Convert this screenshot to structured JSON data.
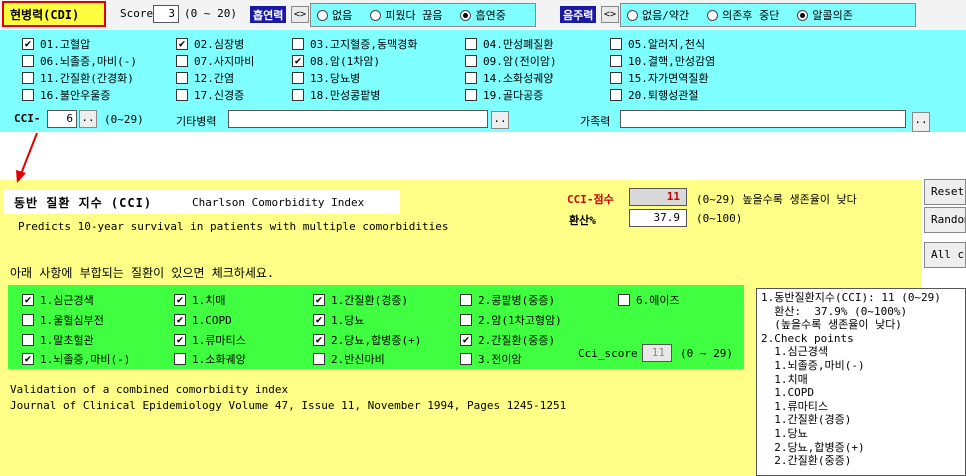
{
  "header": {
    "title": "현병력(CDI)",
    "score_label": "Score",
    "score_value": "3",
    "score_range": "(0 ~ 20)",
    "smoking_label": "흡연력",
    "drinking_label": "음주력",
    "swap_symbol": "<>",
    "smoking_options": [
      {
        "label": "없음",
        "selected": false
      },
      {
        "label": "피웠다 끊음",
        "selected": false
      },
      {
        "label": "흡연중",
        "selected": true
      }
    ],
    "drinking_options": [
      {
        "label": "없음/약간",
        "selected": false
      },
      {
        "label": "의존후 중단",
        "selected": false
      },
      {
        "label": "알콜의존",
        "selected": true
      }
    ]
  },
  "diseases": [
    {
      "label": "01.고혈압",
      "checked": true
    },
    {
      "label": "02.심장병",
      "checked": true
    },
    {
      "label": "03.고지혈증,동맥경화",
      "checked": false
    },
    {
      "label": "04.만성폐질환",
      "checked": false
    },
    {
      "label": "05.알러지,천식",
      "checked": false
    },
    {
      "label": "06.뇌졸증,마비(-)",
      "checked": false
    },
    {
      "label": "07.사지마비",
      "checked": false
    },
    {
      "label": "08.암(1차암)",
      "checked": true
    },
    {
      "label": "09.암(전이암)",
      "checked": false
    },
    {
      "label": "10.결핵,만성감염",
      "checked": false
    },
    {
      "label": "11.간질환(간경화)",
      "checked": false
    },
    {
      "label": "12.간염",
      "checked": false
    },
    {
      "label": "13.당뇨병",
      "checked": false
    },
    {
      "label": "14.소화성궤양",
      "checked": false
    },
    {
      "label": "15.자가면역질환",
      "checked": false
    },
    {
      "label": "16.불안우울증",
      "checked": false
    },
    {
      "label": "17.신경증",
      "checked": false
    },
    {
      "label": "18.만성콩팥병",
      "checked": false
    },
    {
      "label": "19.골다공증",
      "checked": false
    },
    {
      "label": "20.퇴행성관절",
      "checked": false
    }
  ],
  "cci_row": {
    "label": "CCI-",
    "value": "6",
    "dots": "..",
    "range": "(0~29)",
    "other_label": "기타병력",
    "family_label": "가족력"
  },
  "cci_panel": {
    "title": "동반 질환 지수 (CCI)",
    "subtitle": "Charlson Comorbidity Index",
    "description": "Predicts 10-year survival in patients with multiple comorbidities",
    "score_label": "CCI-점수",
    "score_value": "11",
    "score_note": "(0~29)  높을수록 생존율이 낮다",
    "pct_label": "환산%",
    "pct_value": "37.9",
    "pct_range": "(0~100)",
    "instruction": "아래 사항에 부합되는 질환이 있으면 체크하세요.",
    "items": [
      {
        "label": "1.심근경색",
        "checked": true
      },
      {
        "label": "1.치매",
        "checked": true
      },
      {
        "label": "1.간질환(경증)",
        "checked": true
      },
      {
        "label": "2.콩팥병(중증)",
        "checked": false
      },
      {
        "label": "6.에이즈",
        "checked": false
      },
      {
        "label": "1.울혈심부전",
        "checked": false
      },
      {
        "label": "1.COPD",
        "checked": true
      },
      {
        "label": "1.당뇨",
        "checked": true
      },
      {
        "label": "2.암(1차고형암)",
        "checked": false
      },
      {
        "label": "1.말초혈관",
        "checked": false
      },
      {
        "label": "1.류마티스",
        "checked": true
      },
      {
        "label": "2.당뇨,합병증(+)",
        "checked": true
      },
      {
        "label": "2.간질환(중증)",
        "checked": true
      },
      {
        "label": "1.뇌졸증,마비(-)",
        "checked": true
      },
      {
        "label": "1.소화궤양",
        "checked": false
      },
      {
        "label": "2.반신마비",
        "checked": false
      },
      {
        "label": "3.전이암",
        "checked": false
      }
    ],
    "cci_score_label": "Cci_score",
    "cci_score_value": "11",
    "cci_score_range": "(0 ~ 29)",
    "ref_title": "Validation of a combined comorbidity index",
    "ref_journal": "Journal of Clinical Epidemiology Volume 47, Issue 11, November 1994, Pages 1245-1251"
  },
  "buttons": {
    "reset": "Reset",
    "random": "Random",
    "all": "All clear"
  },
  "result_text": "1.동반질환지수(CCI): 11 (0~29)\n  환산:  37.9% (0~100%)\n  (높을수록 생존율이 낮다)\n2.Check points\n  1.심근경색\n  1.뇌졸증,마비(-)\n  1.치매\n  1.COPD\n  1.류마티스\n  1.간질환(경증)\n  1.당뇨\n  2.당뇨,합병증(+)\n  2.간질환(중증)",
  "colors": {
    "cyan_panel": "#7fffff",
    "yellow_panel": "#ffff88",
    "green_panel": "#40ff40",
    "title_border": "#e00000",
    "label_navy": "#1a1aa0",
    "arrow": "#e00000"
  }
}
